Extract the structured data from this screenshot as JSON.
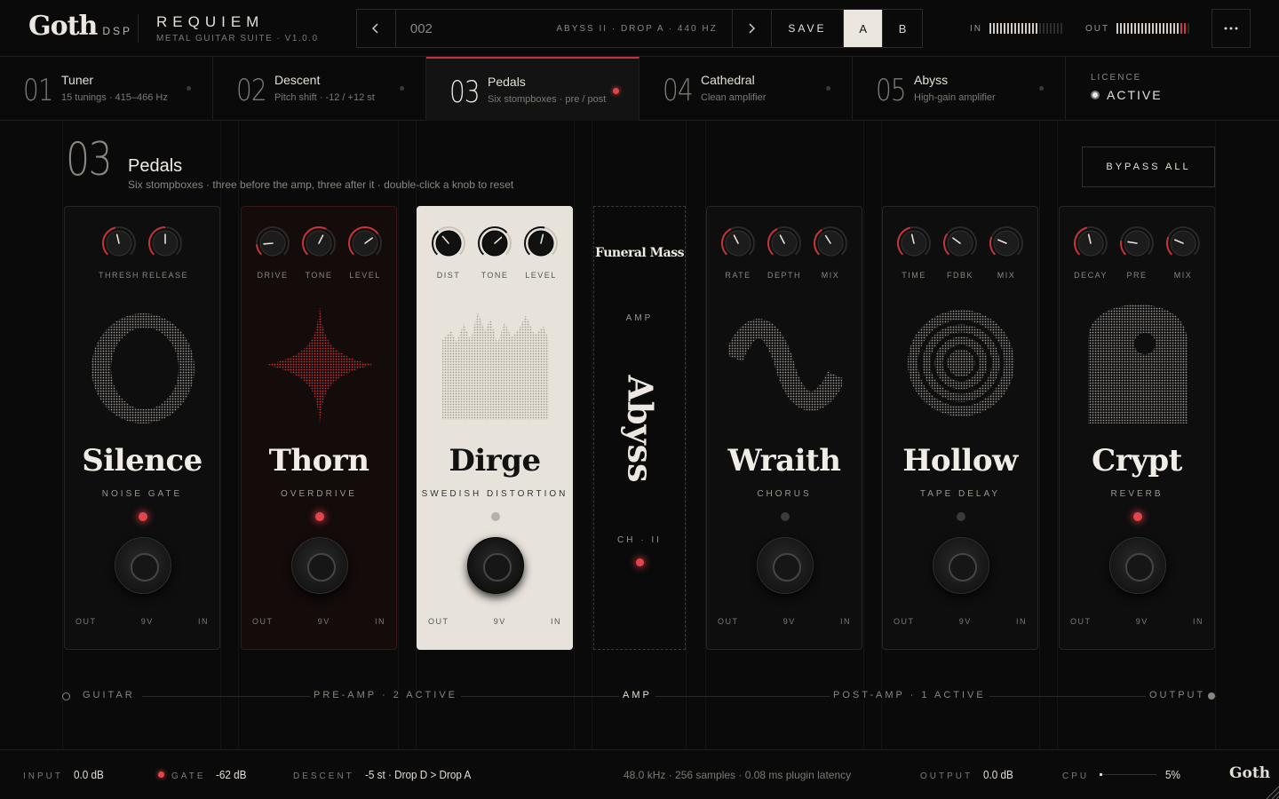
{
  "header": {
    "logo_main": "Goth",
    "logo_sub": "DSP",
    "product_name": "REQUIEM",
    "product_sub": "METAL GUITAR SUITE · V1.0.0",
    "preset_number": "002",
    "preset_name": "Funeral Mass",
    "preset_meta": "ABYSS II · DROP A · 440 HZ",
    "save_label": "SAVE",
    "slot_a": "A",
    "slot_b": "B",
    "active_slot": "A",
    "in_label": "IN",
    "out_label": "OUT",
    "in_level": 0.67,
    "out_level": 0.93,
    "prev_icon": "chevron-left-icon",
    "next_icon": "chevron-right-icon",
    "menu_icon": "more-horizontal-icon"
  },
  "tabs": [
    {
      "number": "01",
      "title": "Tuner",
      "subtitle": "15 tunings · 415–466 Hz",
      "active": false
    },
    {
      "number": "02",
      "title": "Descent",
      "subtitle": "Pitch shift · -12 / +12 st",
      "active": false
    },
    {
      "number": "03",
      "title": "Pedals",
      "subtitle": "Six stompboxes · pre / post",
      "active": true
    },
    {
      "number": "04",
      "title": "Cathedral",
      "subtitle": "Clean amplifier",
      "active": false
    },
    {
      "number": "05",
      "title": "Abyss",
      "subtitle": "High-gain amplifier",
      "active": false
    }
  ],
  "licence": {
    "label": "LICENCE",
    "value": "ACTIVE"
  },
  "section": {
    "number": "03",
    "title": "Pedals",
    "subtitle": "Six stompboxes · three before the amp, three after it · double-click a knob to reset",
    "bypass_label": "BYPASS ALL"
  },
  "pedals": [
    {
      "name": "Silence",
      "type": "NOISE GATE",
      "on": true,
      "theme": "dark",
      "accent": "#c6343a",
      "knobs": [
        {
          "label": "THRESH",
          "value": 0.45
        },
        {
          "label": "RELEASE",
          "value": 0.5
        }
      ],
      "jacks": [
        "OUT",
        "9V",
        "IN"
      ],
      "art_icon": "ring-halftone-icon"
    },
    {
      "name": "Thorn",
      "type": "OVERDRIVE",
      "on": true,
      "theme": "red",
      "accent": "#c6343a",
      "knobs": [
        {
          "label": "DRIVE",
          "value": 0.15
        },
        {
          "label": "TONE",
          "value": 0.6
        },
        {
          "label": "LEVEL",
          "value": 0.7
        }
      ],
      "jacks": [
        "OUT",
        "9V",
        "IN"
      ],
      "art_icon": "spike-star-icon"
    },
    {
      "name": "Dirge",
      "type": "SWEDISH DISTORTION",
      "on": false,
      "theme": "light",
      "accent": "#111111",
      "knobs": [
        {
          "label": "DIST",
          "value": 0.35
        },
        {
          "label": "TONE",
          "value": 0.68
        },
        {
          "label": "LEVEL",
          "value": 0.55
        }
      ],
      "jacks": [
        "OUT",
        "9V",
        "IN"
      ],
      "art_icon": "waveform-spikes-icon"
    },
    {
      "name": "Wraith",
      "type": "CHORUS",
      "on": false,
      "theme": "dark",
      "accent": "#c6343a",
      "knobs": [
        {
          "label": "RATE",
          "value": 0.4
        },
        {
          "label": "DEPTH",
          "value": 0.4
        },
        {
          "label": "MIX",
          "value": 0.38
        }
      ],
      "jacks": [
        "OUT",
        "9V",
        "IN"
      ],
      "art_icon": "sine-wave-icon"
    },
    {
      "name": "Hollow",
      "type": "TAPE DELAY",
      "on": false,
      "theme": "dark",
      "accent": "#c6343a",
      "knobs": [
        {
          "label": "TIME",
          "value": 0.45
        },
        {
          "label": "FDBK",
          "value": 0.3
        },
        {
          "label": "MIX",
          "value": 0.25
        }
      ],
      "jacks": [
        "OUT",
        "9V",
        "IN"
      ],
      "art_icon": "concentric-rings-icon"
    },
    {
      "name": "Crypt",
      "type": "REVERB",
      "on": true,
      "theme": "dark",
      "accent": "#c6343a",
      "knobs": [
        {
          "label": "DECAY",
          "value": 0.45
        },
        {
          "label": "PRE",
          "value": 0.2
        },
        {
          "label": "MIX",
          "value": 0.25
        }
      ],
      "jacks": [
        "OUT",
        "9V",
        "IN"
      ],
      "art_icon": "tombstone-icon"
    }
  ],
  "amp": {
    "label": "AMP",
    "name": "Abyss",
    "channel": "CH · II"
  },
  "chain": {
    "guitar": "GUITAR",
    "pre_amp": "PRE-AMP · 2 ACTIVE",
    "amp": "AMP",
    "post_amp": "POST-AMP · 1 ACTIVE",
    "output": "OUTPUT"
  },
  "footer": {
    "input_label": "INPUT",
    "input_value": "0.0 dB",
    "gate_label": "GATE",
    "gate_value": "-62 dB",
    "descent_label": "DESCENT",
    "descent_value": "-5 st · Drop D > Drop A",
    "status": "48.0 kHz · 256 samples · 0.08 ms plugin latency",
    "output_label": "OUTPUT",
    "output_value": "0.0 dB",
    "cpu_label": "CPU",
    "cpu_value": "5%",
    "cpu_level": 0.05,
    "logo": "Goth"
  },
  "colors": {
    "accent_red": "#c6343a",
    "background": "#0a0a0a",
    "ivory": "#e8e3da"
  }
}
